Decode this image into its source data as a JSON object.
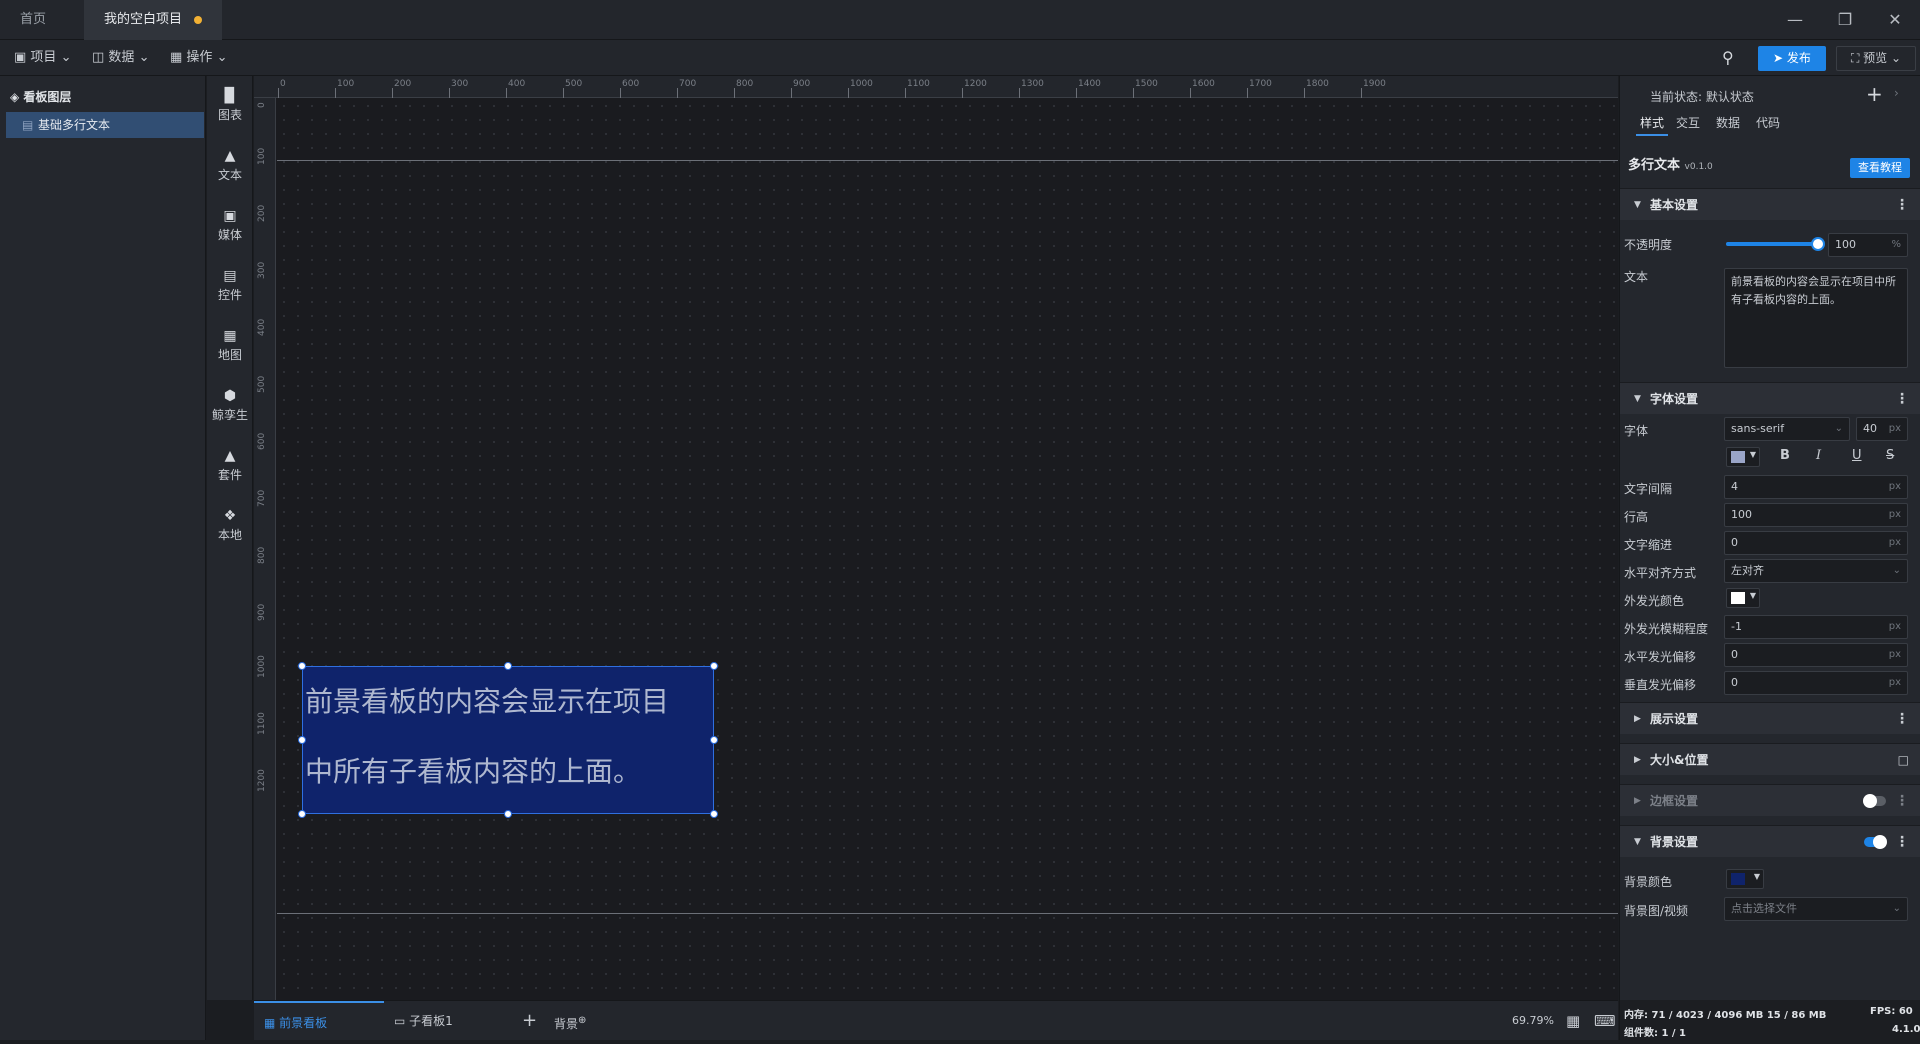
{
  "titlebar": {
    "tabs": [
      "首页",
      "我的空白项目"
    ],
    "window_buttons": [
      "minimize-icon",
      "restore-icon",
      "close-icon"
    ]
  },
  "toolbar": {
    "menus": [
      "项目",
      "数据",
      "操作"
    ],
    "publish": "发布",
    "preview": "预览"
  },
  "layers": {
    "title": "看板图层",
    "items": [
      "基础多行文本"
    ]
  },
  "components": [
    "图表",
    "文本",
    "媒体",
    "控件",
    "地图",
    "鲸孪生",
    "套件",
    "本地"
  ],
  "ruler": {
    "top": [
      "0",
      "100",
      "200",
      "300",
      "400",
      "500",
      "600",
      "700",
      "800",
      "900",
      "1000",
      "1100",
      "1200",
      "1300",
      "1400",
      "1500",
      "1600",
      "1700",
      "1800",
      "1900"
    ],
    "left": [
      "0",
      "100",
      "200",
      "300",
      "400",
      "500",
      "600",
      "700",
      "800",
      "900",
      "1000",
      "1100",
      "1200"
    ]
  },
  "canvas": {
    "text_line1": "前景看板的内容会显示在项目",
    "text_line2": "中所有子看板内容的上面。"
  },
  "bottom": {
    "tabs": [
      "前景看板",
      "子看板1"
    ],
    "add": "+",
    "background": "背景",
    "zoom": "69.79%"
  },
  "right": {
    "state_label": "当前状态:",
    "state_value": "默认状态",
    "tabs": [
      "样式",
      "交互",
      "数据",
      "代码"
    ],
    "component_name": "多行文本",
    "version": "v0.1.0",
    "tutorial": "查看教程",
    "basic": {
      "title": "基本设置",
      "opacity_label": "不透明度",
      "opacity_value": "100",
      "opacity_unit": "%",
      "opacity_fraction": 1.0,
      "text_label": "文本",
      "text_value": "前景看板的内容会显示在项目中所有子看板内容的上面。"
    },
    "font": {
      "title": "字体设置",
      "font_label": "字体",
      "font_family": "sans-serif",
      "font_size": "40",
      "spacing_label": "文字间隔",
      "spacing_value": "4",
      "lineheight_label": "行高",
      "lineheight_value": "100",
      "indent_label": "文字缩进",
      "indent_value": "0",
      "align_label": "水平对齐方式",
      "align_value": "左对齐",
      "glow_color_label": "外发光颜色",
      "glow_blur_label": "外发光模糊程度",
      "glow_blur_value": "-1",
      "glow_h_label": "水平发光偏移",
      "glow_h_value": "0",
      "glow_v_label": "垂直发光偏移",
      "glow_v_value": "0",
      "unit": "px"
    },
    "sections": {
      "display": "展示设置",
      "size_position": "大小&位置",
      "border": "边框设置",
      "background": "背景设置"
    },
    "bg": {
      "color_label": "背景颜色",
      "image_label": "背景图/视频",
      "image_placeholder": "点击选择文件"
    }
  },
  "status": {
    "memory": "内存: 71 / 4023 / 4096 MB 15 / 86 MB",
    "fps": "FPS: 60",
    "components": "组件数: 1 / 1",
    "version": "4.1.0"
  },
  "colors": {
    "accent": "#1e84e6",
    "textbox_bg": "#0f236b",
    "font_color": "#9aa5c8",
    "bg_color": "#0f236b",
    "glow_color": "#ffffff"
  }
}
